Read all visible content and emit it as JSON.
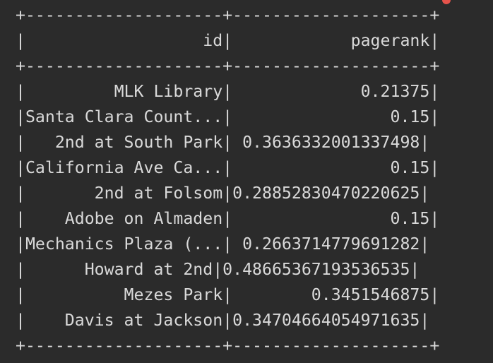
{
  "table": {
    "border": "+--------------------+--------------------+",
    "header": "|                  id|            pagerank|",
    "rows": [
      "|         MLK Library|             0.21375|",
      "|Santa Clara Count...|                0.15|",
      "|   2nd at South Park| 0.3636332001337498|",
      "|California Ave Ca...|                0.15|",
      "|       2nd at Folsom|0.28852830470220625|",
      "|    Adobe on Almaden|                0.15|",
      "|Mechanics Plaza (...| 0.2663714779691282|",
      "|      Howard at 2nd|0.48665367193536535|",
      "|          Mezes Park|        0.3451546875|",
      "|    Davis at Jackson|0.34704664054971635|"
    ]
  },
  "colors": {
    "background": "#2b2b2b",
    "text": "#d9d9d9",
    "indicator": "#e5534b"
  }
}
